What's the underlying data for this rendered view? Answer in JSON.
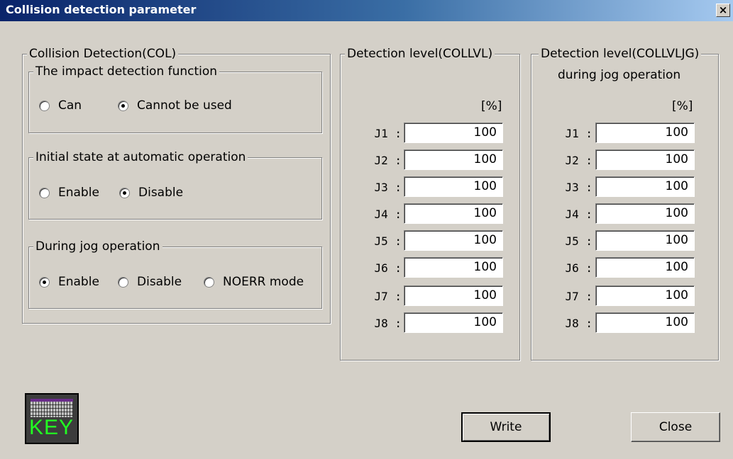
{
  "window": {
    "title": "Collision detection parameter",
    "close_glyph": "×"
  },
  "col_group": {
    "title": "Collision Detection(COL)",
    "impact": {
      "title": "The impact detection function",
      "options": [
        {
          "label": "Can",
          "selected": false
        },
        {
          "label": "Cannot be used",
          "selected": true
        }
      ]
    },
    "initial": {
      "title": "Initial state at automatic operation",
      "options": [
        {
          "label": "Enable",
          "selected": false
        },
        {
          "label": "Disable",
          "selected": true
        }
      ]
    },
    "jog": {
      "title": "During jog operation",
      "options": [
        {
          "label": "Enable",
          "selected": true
        },
        {
          "label": "Disable",
          "selected": false
        },
        {
          "label": "NOERR mode",
          "selected": false
        }
      ]
    }
  },
  "collvl": {
    "title": "Detection level(COLLVL)",
    "unit": "[%]",
    "labels": [
      "J1 :",
      "J2 :",
      "J3 :",
      "J4 :",
      "J5 :",
      "J6 :",
      "J7 :",
      "J8 :"
    ],
    "values": [
      "100",
      "100",
      "100",
      "100",
      "100",
      "100",
      "100",
      "100"
    ]
  },
  "collvljg": {
    "title_line1": "Detection level(COLLVLJG)",
    "title_line2": "during jog operation",
    "unit": "[%]",
    "labels": [
      "J1 :",
      "J2 :",
      "J3 :",
      "J4 :",
      "J5 :",
      "J6 :",
      "J7 :",
      "J8 :"
    ],
    "values": [
      "100",
      "100",
      "100",
      "100",
      "100",
      "100",
      "100",
      "100"
    ]
  },
  "key_icon": {
    "label": "KEY",
    "icon": "keyboard-icon"
  },
  "buttons": {
    "write": "Write",
    "close": "Close"
  }
}
